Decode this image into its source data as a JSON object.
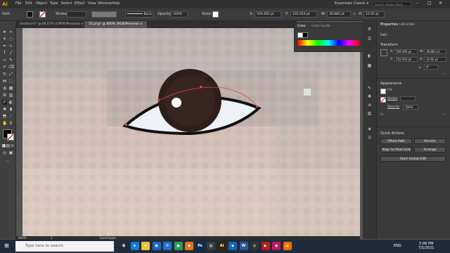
{
  "app": {
    "logo": "Ai",
    "workspace": "Essentials Classic ▾",
    "search_placeholder": "Search Adobe Stock"
  },
  "menu": [
    "File",
    "Edit",
    "Object",
    "Type",
    "Select",
    "Effect",
    "View",
    "Window",
    "Help"
  ],
  "controlbar": {
    "selection": "Path",
    "stroke_label": "Stroke:",
    "stroke_style": "Basic",
    "opacity_label": "Opacity:",
    "opacity_value": "100%",
    "style_label": "Style:",
    "x_label": "X:",
    "x_value": "509.492 pt",
    "y_label": "Y:",
    "y_value": "232.054 pt",
    "w_label": "W:",
    "w_value": "36.882 pt",
    "h_label": "H:",
    "h_value": "12.92 pt"
  },
  "doc_tabs": [
    {
      "label": "Untitled-1* @ 66.67% (CMYK/Preview)  ×",
      "active": false
    },
    {
      "label": "55.png* @ 800% (RGB/Preview)  ×",
      "active": true
    }
  ],
  "color_panel": {
    "tab1": "Color",
    "tab2": "Color Guide"
  },
  "properties": {
    "tab1": "Properties",
    "tab2": "Libraries",
    "selection": "Path",
    "transform_title": "Transform",
    "x_label": "X:",
    "x_value": "509.492 pt",
    "y_label": "Y:",
    "y_value": "232.054 pt",
    "w_label": "W:",
    "w_value": "36.882 pt",
    "h_label": "H:",
    "h_value": "12.92 pt",
    "angle_value": "0°",
    "appearance_title": "Appearance",
    "fill_label": "Fill",
    "stroke_label": "Stroke",
    "opacity_label": "Opacity",
    "opacity_value": "100%",
    "fx_label": "fx.",
    "quick_actions_title": "Quick Actions",
    "offset_path": "Offset Path",
    "recolor": "Recolor",
    "align_pixel": "Align to Pixel Grid",
    "arrange": "Arrange",
    "start_global_edit": "Start Global Edit"
  },
  "status": {
    "zoom": "800%",
    "page": "1",
    "tool": "Eyedropper"
  },
  "taskbar": {
    "search_placeholder": "Type here to search",
    "icons": [
      {
        "name": "task-view",
        "glyph": "⧉",
        "color": "#1f2b3a"
      },
      {
        "name": "edge",
        "glyph": "e",
        "color": "#0f7bd6"
      },
      {
        "name": "explorer",
        "glyph": "▰",
        "color": "#f0c13b"
      },
      {
        "name": "store",
        "glyph": "▣",
        "color": "#1d67c4"
      },
      {
        "name": "mail",
        "glyph": "✉",
        "color": "#2271c8"
      },
      {
        "name": "chrome",
        "glyph": "●",
        "color": "#2e9c52"
      },
      {
        "name": "firefox",
        "glyph": "◉",
        "color": "#e2761b"
      },
      {
        "name": "photoshop",
        "glyph": "Ps",
        "color": "#0b2d4f"
      },
      {
        "name": "files",
        "glyph": "▤",
        "color": "#3c3c3c"
      },
      {
        "name": "illustrator",
        "glyph": "Ai",
        "color": "#3a2100"
      },
      {
        "name": "app-blue",
        "glyph": "◆",
        "color": "#1565c0"
      },
      {
        "name": "word",
        "glyph": "W",
        "color": "#2b579a"
      },
      {
        "name": "camera",
        "glyph": "◎",
        "color": "#333"
      },
      {
        "name": "media",
        "glyph": "▶",
        "color": "#b71c1c"
      },
      {
        "name": "browser",
        "glyph": "◉",
        "color": "#c2185b"
      },
      {
        "name": "files2",
        "glyph": "▤",
        "color": "#ef6c00"
      }
    ],
    "time": "5:06 PM",
    "date": "7/1/2021",
    "lang": "ENG"
  }
}
